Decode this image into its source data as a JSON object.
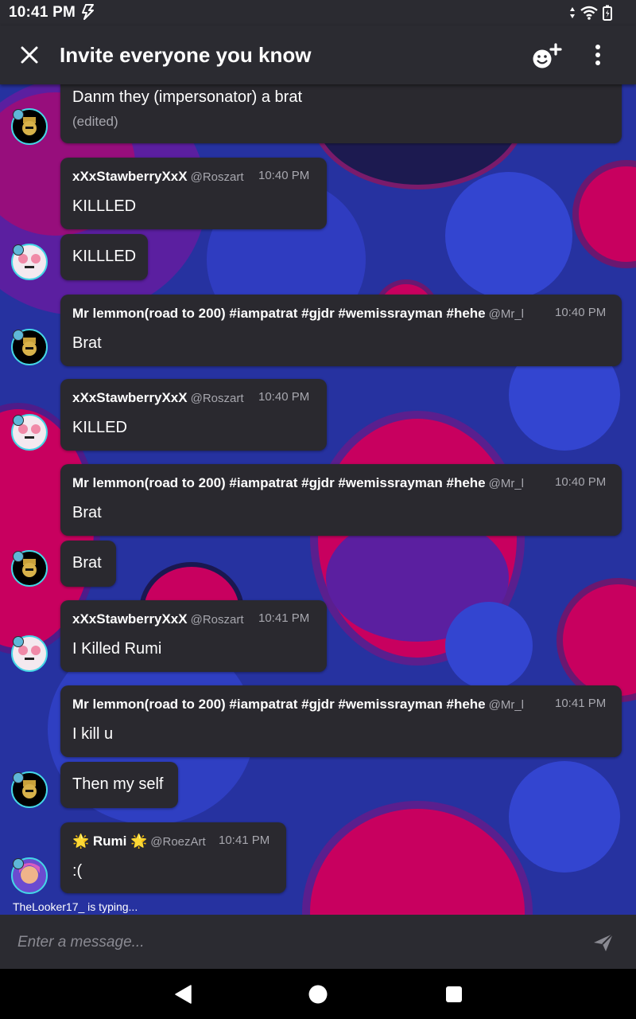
{
  "status_bar": {
    "time": "10:41 PM"
  },
  "app_bar": {
    "title": "Invite everyone you know"
  },
  "messages": [
    {
      "text": "Danm they (impersonator) a brat",
      "edited": "(edited)"
    },
    {
      "name": "xXxStawberryXxX",
      "handle": "@Roszart",
      "time": "10:40 PM",
      "text": "KILLLED"
    },
    {
      "text": "KILLLED"
    },
    {
      "name": "Mr lemmon(road to 200) #iampatrat #gjdr #wemissrayman #hehe",
      "handle": "@Mr_l",
      "time": "10:40 PM",
      "text": "Brat"
    },
    {
      "name": "xXxStawberryXxX",
      "handle": "@Roszart",
      "time": "10:40 PM",
      "text": "KILLED"
    },
    {
      "name": "Mr lemmon(road to 200) #iampatrat #gjdr #wemissrayman #hehe",
      "handle": "@Mr_l",
      "time": "10:40 PM",
      "text": "Brat"
    },
    {
      "text": "Brat"
    },
    {
      "name": "xXxStawberryXxX",
      "handle": "@Roszart",
      "time": "10:41 PM",
      "text": "I Killed Rumi"
    },
    {
      "name": "Mr lemmon(road to 200) #iampatrat #gjdr #wemissrayman #hehe",
      "handle": "@Mr_l",
      "time": "10:41 PM",
      "text": "I kill u"
    },
    {
      "text": "Then my self"
    },
    {
      "name": "🌟 Rumi 🌟",
      "handle": "@RoezArt",
      "time": "10:41 PM",
      "text": ":("
    }
  ],
  "typing_indicator": "TheLooker17_  is typing...",
  "composer": {
    "placeholder": "Enter a message..."
  },
  "colors": {
    "bar": "#2b2b31",
    "bubble": "#2a292f",
    "accent_cyan": "#44d6e6",
    "bg_blue": "#2632a0",
    "bg_magenta": "#c8005f"
  },
  "icons": {
    "close": "close-icon",
    "add_friend": "add-friend-icon",
    "more": "more-vert-icon",
    "send": "send-icon",
    "nav_back": "back-triangle-icon",
    "nav_home": "home-circle-icon",
    "nav_recent": "recent-square-icon"
  }
}
